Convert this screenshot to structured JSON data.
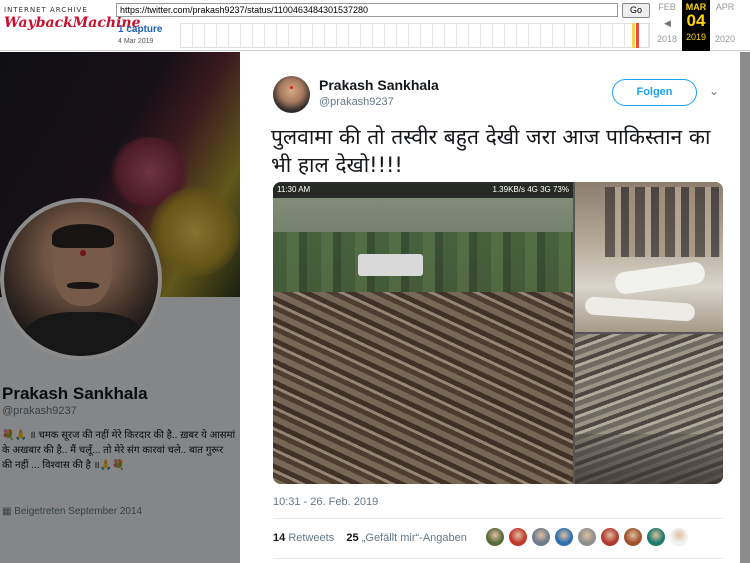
{
  "wayback": {
    "logo_top": "INTERNET ARCHIVE",
    "logo_main": "WaybackMachine",
    "url": "https://twitter.com/prakash9237/status/1100463484301537280",
    "go_label": "Go",
    "captures": "1 capture",
    "capture_date": "4 Mar 2019",
    "prev_month": "FEB",
    "cur_month": "MAR",
    "next_month": "APR",
    "cur_day": "04",
    "prev_year": "2018",
    "cur_year": "2019",
    "next_year": "2020"
  },
  "profile": {
    "name": "Prakash Sankhala",
    "handle": "@prakash9237",
    "bio": "💐🙏 ॥ चमक सूरज की नहीं मेरे किरदार की है.. ख़बर ये आसमां के अखबार की है.. मैं चलूँ... तो मेरे संग कारवां चले.. बात गुरूर की नहीं ... विश्वास की है ॥🙏💐",
    "joined": "Beigetreten September 2014"
  },
  "tweet": {
    "author_name": "Prakash Sankhala",
    "author_handle": "@prakash9237",
    "follow_label": "Folgen",
    "text": "पुलवामा की तो तस्वीर बहुत देखी जरा आज पाकिस्तान का भी हाल देखो!!!!",
    "status_left": "11:30 AM",
    "status_right": "1.39KB/s 4G 3G 73%",
    "timestamp": "10:31 - 26. Feb. 2019",
    "retweets_count": "14",
    "retweets_label": "Retweets",
    "likes_count": "25",
    "likes_label": "„Gefällt mir“-Angaben"
  },
  "likers_colors": [
    "#5a6a3a",
    "#c0392b",
    "#6d7b8d",
    "#2e6fb0",
    "#8e8e8e",
    "#b03a2e",
    "#a0522d",
    "#1e7a6a",
    "#f2f2f2"
  ]
}
